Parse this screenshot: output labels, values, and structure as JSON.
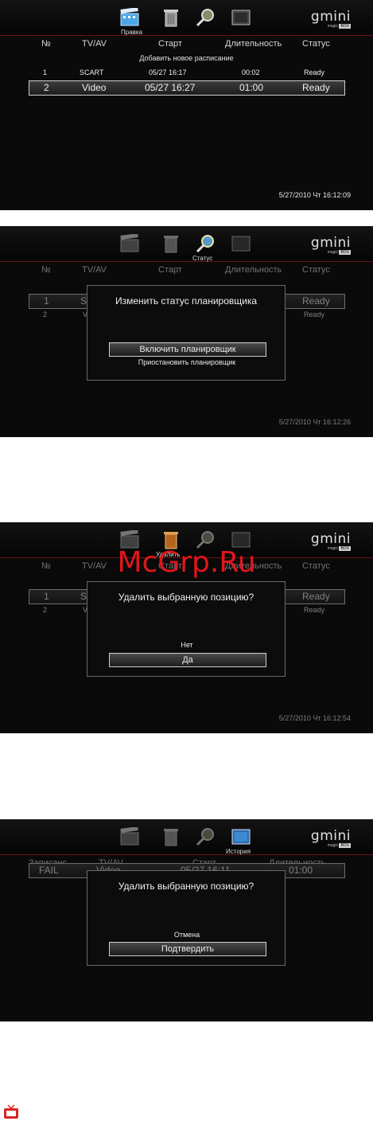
{
  "logo": {
    "brand": "gmini",
    "sub": "magic",
    "badge": "BOX"
  },
  "columns": [
    "№",
    "TV/AV",
    "Старт",
    "Длительность",
    "Статус"
  ],
  "history_columns": [
    "Записанс",
    "TV/AV",
    "Старт",
    "Длительность"
  ],
  "add_schedule_label": "Добавить новое расписание",
  "screen1": {
    "caption": "Правка",
    "rows": [
      {
        "num": "1",
        "source": "SCART",
        "start": "05/27 16:17",
        "duration": "00:02",
        "status": "Ready"
      },
      {
        "num": "2",
        "source": "Video",
        "start": "05/27 16:27",
        "duration": "01:00",
        "status": "Ready"
      }
    ],
    "clock": "5/27/2010 Чт 16:12:09"
  },
  "screen2": {
    "caption": "Статус",
    "row1": {
      "num": "1",
      "source": "SC",
      "status": "Ready"
    },
    "row2": {
      "num": "2",
      "source": "V",
      "status": "Ready"
    },
    "dialog_title": "Изменить статус планировщика",
    "option_selected": "Включить планировщик",
    "option_other": "Приостановить планировщик",
    "clock": "5/27/2010 Чт 16:12:26"
  },
  "screen3": {
    "caption": "Удалить",
    "row1": {
      "num": "1",
      "source": "SC",
      "status": "Ready"
    },
    "row2": {
      "num": "2",
      "source": "V",
      "status": "Ready"
    },
    "dialog_title": "Удалить выбранную позицию?",
    "option_other": "Нет",
    "option_selected": "Да",
    "clock": "5/27/2010 Чт 16:12:54"
  },
  "screen4": {
    "caption": "История",
    "row": {
      "status": "FAIL",
      "source": "Video",
      "start": "05/27 16:11",
      "duration": "01:00"
    },
    "dialog_title": "Удалить выбранную позицию?",
    "option_other": "Отмена",
    "option_selected": "Подтвердить"
  },
  "watermark": "McGrp.Ru",
  "colors": {
    "accent_line": "#6b1616",
    "watermark": "#e0161b",
    "screen_bg": "#0a0a0a"
  }
}
